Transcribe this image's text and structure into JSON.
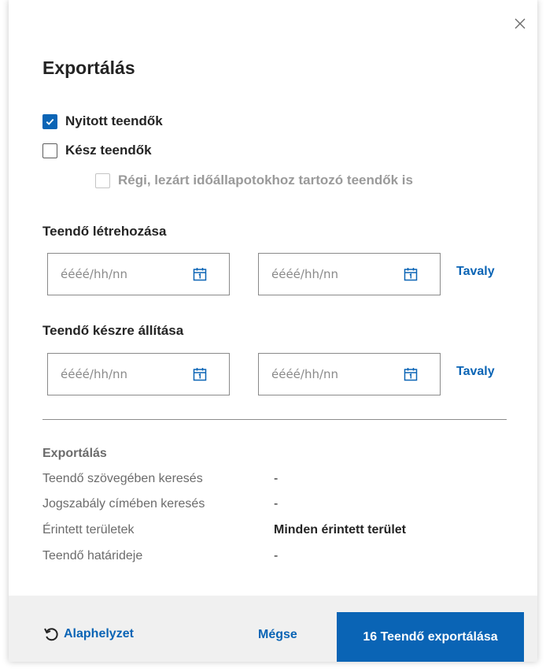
{
  "dialog": {
    "title": "Exportálás"
  },
  "options": {
    "open_tasks": {
      "label": "Nyitott teendők",
      "checked": true
    },
    "done_tasks": {
      "label": "Kész teendők",
      "checked": false
    },
    "old_tasks": {
      "label": "Régi, lezárt időállapotokhoz tartozó teendők is",
      "checked": false,
      "disabled": true
    }
  },
  "created": {
    "label": "Teendő létrehozása",
    "from_placeholder": "éééé/hh/nn",
    "to_placeholder": "éééé/hh/nn",
    "shortcut": "Tavaly"
  },
  "completed": {
    "label": "Teendő készre állítása",
    "from_placeholder": "éééé/hh/nn",
    "to_placeholder": "éééé/hh/nn",
    "shortcut": "Tavaly"
  },
  "summary": {
    "title": "Exportálás",
    "rows": [
      {
        "label": "Teendő szövegében keresés",
        "value": "-"
      },
      {
        "label": "Jogszabály címében keresés",
        "value": "-"
      },
      {
        "label": "Érintett területek",
        "value": "Minden érintett terület"
      },
      {
        "label": "Teendő határideje",
        "value": "-"
      }
    ]
  },
  "footer": {
    "reset_label": "Alaphelyzet",
    "cancel_label": "Mégse",
    "export_label": "16 Teendő exportálása"
  },
  "colors": {
    "accent": "#0a64b5",
    "footer_bg": "#f0f0f0"
  },
  "icons": {
    "close": "close-icon",
    "calendar": "calendar-icon",
    "reset": "reset-icon",
    "check": "check-icon"
  }
}
